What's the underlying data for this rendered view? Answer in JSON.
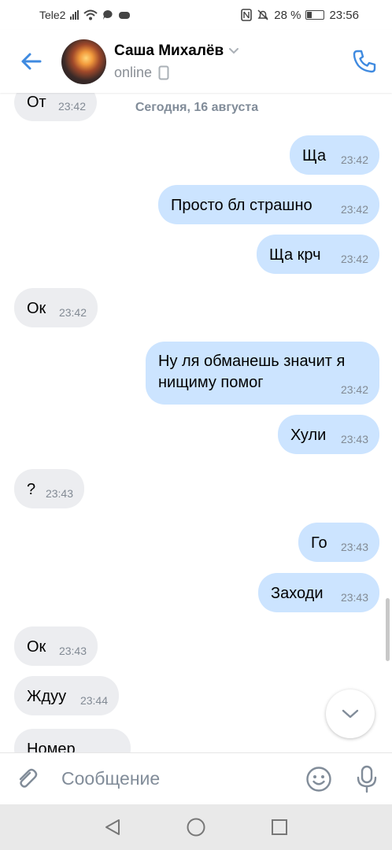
{
  "status_bar": {
    "carrier": "Tele2",
    "battery": "28 %",
    "time": "23:56"
  },
  "header": {
    "name": "Саша Михалёв",
    "status": "online"
  },
  "date_separator": "Сегодня, 16 августа",
  "messages": [
    {
      "dir": "in",
      "text": "От",
      "time": "23:42"
    },
    {
      "dir": "out",
      "text": "Ща",
      "time": "23:42"
    },
    {
      "dir": "out",
      "text": "Просто бл страшно",
      "time": "23:42"
    },
    {
      "dir": "out",
      "text": "Ща крч",
      "time": "23:42"
    },
    {
      "dir": "in",
      "text": "Ок",
      "time": "23:42"
    },
    {
      "dir": "out",
      "text": "Ну ля обманешь значит я нищиму помог",
      "time": "23:42"
    },
    {
      "dir": "out",
      "text": "Хули",
      "time": "23:43"
    },
    {
      "dir": "in",
      "text": "?",
      "time": "23:43"
    },
    {
      "dir": "out",
      "text": "Го",
      "time": "23:43"
    },
    {
      "dir": "out",
      "text": "Заходи",
      "time": "23:43"
    },
    {
      "dir": "in",
      "text": "Ок",
      "time": "23:43"
    },
    {
      "dir": "in",
      "text": "Ждуу",
      "time": "23:44"
    },
    {
      "dir": "in",
      "text": "Номер",
      "time": ""
    }
  ],
  "composer": {
    "placeholder": "Сообщение"
  },
  "colors": {
    "accent": "#3f8ae0",
    "outgoing_bubble": "#cce4ff",
    "incoming_bubble": "#ecedf0"
  },
  "icons": {
    "back": "arrow-left-icon",
    "call": "phone-call-icon",
    "attach": "paperclip-icon",
    "emoji": "smile-icon",
    "mic": "microphone-icon",
    "scroll_down": "chevron-down-icon"
  }
}
